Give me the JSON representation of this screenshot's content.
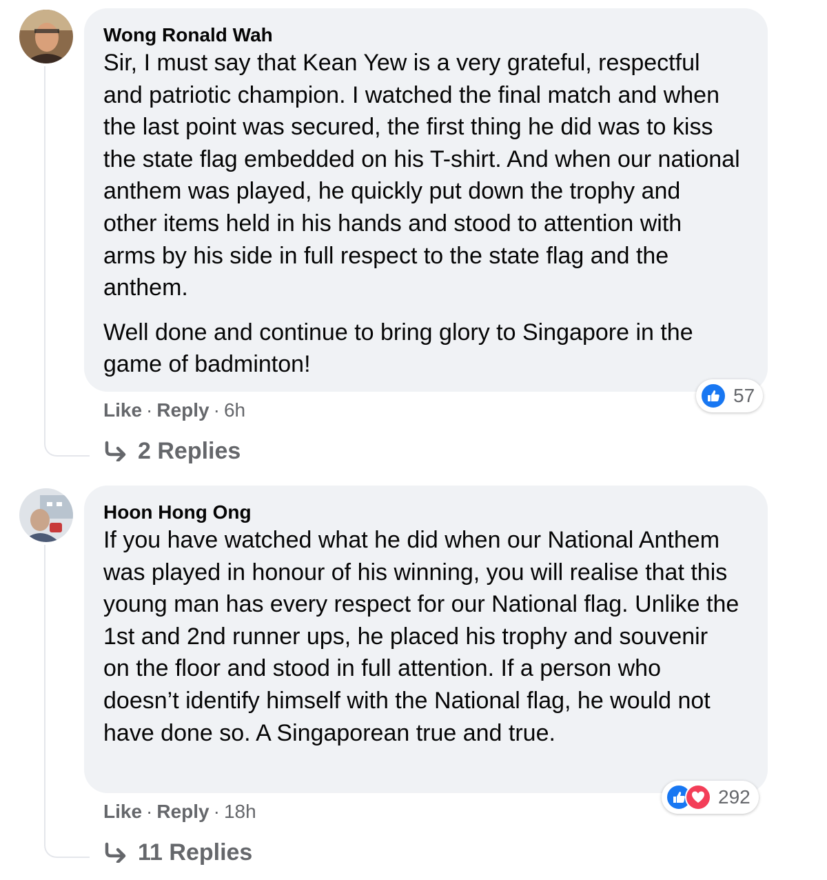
{
  "comments": [
    {
      "author": "Wong Ronald Wah",
      "paragraphs": [
        "Sir, I must say that Kean Yew is a very grateful, respectful and patriotic champion. I watched the final match and when the last point was secured, the first thing he did was to kiss the state flag embedded on his T-shirt. And when our national anthem was played, he quickly put down the trophy and other items held in his hands and stood to attention with arms by his side in full respect to the state flag and the anthem.",
        "Well done and continue to bring glory to Singapore in the game of badminton!"
      ],
      "like_label": "Like",
      "reply_label": "Reply",
      "time": "6h",
      "reaction_count": "57",
      "reactions": [
        "like-icon"
      ],
      "replies_label": "2 Replies"
    },
    {
      "author": "Hoon Hong Ong",
      "paragraphs": [
        "If you have watched what he did when our National Anthem was played in honour of his winning, you will realise that this young man has every respect for our National flag. Unlike the 1st and 2nd runner ups, he placed his trophy and souvenir on the floor and stood in full attention. If a person who doesn’t identify himself with the National flag, he would not have done so. A Singaporean true and true."
      ],
      "like_label": "Like",
      "reply_label": "Reply",
      "time": "18h",
      "reaction_count": "292",
      "reactions": [
        "like-icon",
        "love-icon"
      ],
      "replies_label": "11 Replies"
    }
  ],
  "separator": "·",
  "colors": {
    "bubble": "#f0f2f5",
    "meta_text": "#65676b",
    "like_blue": "#1877f2",
    "love_red": "#f33e58"
  }
}
